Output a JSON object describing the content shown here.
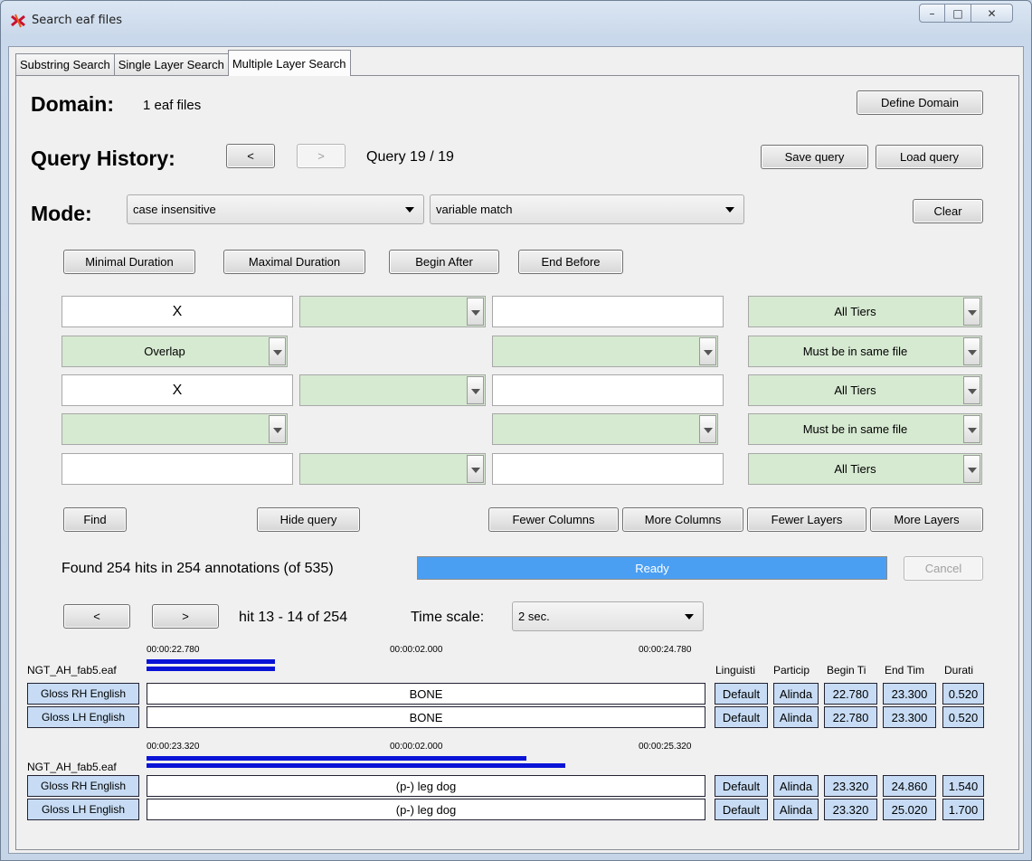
{
  "window": {
    "title": "Search eaf files",
    "controls": {
      "minimize": "–",
      "maximize": "□",
      "close": "✕"
    }
  },
  "tabs": [
    {
      "label": "Substring Search",
      "active": false
    },
    {
      "label": "Single Layer Search",
      "active": false
    },
    {
      "label": "Multiple Layer Search",
      "active": true
    }
  ],
  "domain": {
    "heading": "Domain:",
    "value": "1 eaf files",
    "define_button": "Define Domain"
  },
  "history": {
    "heading": "Query History:",
    "prev": "<",
    "next": ">",
    "status": "Query 19 / 19",
    "save_button": "Save query",
    "load_button": "Load query"
  },
  "mode": {
    "heading": "Mode:",
    "case_select": "case insensitive",
    "match_select": "variable match",
    "clear_button": "Clear"
  },
  "constraints": {
    "min_duration": "Minimal Duration",
    "max_duration": "Maximal Duration",
    "begin_after": "Begin After",
    "end_before": "End Before"
  },
  "query_grid": {
    "row1": {
      "pattern": "X",
      "op": "",
      "pattern2": "",
      "tiers": "All Tiers"
    },
    "rel1": {
      "relation": "Overlap",
      "op": "",
      "file": "Must be in same file"
    },
    "row2": {
      "pattern": "X",
      "op": "",
      "pattern2": "",
      "tiers": "All Tiers"
    },
    "rel2": {
      "relation": "",
      "op": "",
      "file": "Must be in same file"
    },
    "row3": {
      "pattern": "",
      "op": "",
      "pattern2": "",
      "tiers": "All Tiers"
    }
  },
  "actions": {
    "find": "Find",
    "hide_query": "Hide query",
    "fewer_columns": "Fewer Columns",
    "more_columns": "More Columns",
    "fewer_layers": "Fewer Layers",
    "more_layers": "More Layers"
  },
  "results": {
    "summary": "Found 254 hits in 254 annotations (of 535)",
    "progress_label": "Ready",
    "progress_value": 1.0,
    "cancel": "Cancel",
    "prev": "<",
    "next": ">",
    "hit_range": "hit 13 - 14 of 254",
    "timescale_label": "Time scale:",
    "timescale_value": "2 sec."
  },
  "column_headers": [
    "Linguisti",
    "Particip",
    "Begin Ti",
    "End Tim",
    "Durati"
  ],
  "hits": [
    {
      "file": "NGT_AH_fab5.eaf",
      "ticks": [
        "00:00:22.780",
        "00:00:02.000",
        "00:00:24.780"
      ],
      "rows": [
        {
          "tier": "Gloss RH English",
          "annotation": "BONE",
          "linguistic": "Default",
          "participant": "Alinda",
          "begin": "22.780",
          "end": "23.300",
          "duration": "0.520"
        },
        {
          "tier": "Gloss LH English",
          "annotation": "BONE",
          "linguistic": "Default",
          "participant": "Alinda",
          "begin": "22.780",
          "end": "23.300",
          "duration": "0.520"
        }
      ]
    },
    {
      "file": "NGT_AH_fab5.eaf",
      "ticks": [
        "00:00:23.320",
        "00:00:02.000",
        "00:00:25.320"
      ],
      "rows": [
        {
          "tier": "Gloss RH English",
          "annotation": "(p-) leg dog",
          "linguistic": "Default",
          "participant": "Alinda",
          "begin": "23.320",
          "end": "24.860",
          "duration": "1.540"
        },
        {
          "tier": "Gloss LH English",
          "annotation": "(p-) leg dog",
          "linguistic": "Default",
          "participant": "Alinda",
          "begin": "23.320",
          "end": "25.020",
          "duration": "1.700"
        }
      ]
    }
  ],
  "colors": {
    "bar": "#0a14d6",
    "progress": "#4b9ff2",
    "green_field": "#d6e9d1",
    "tier_bg": "#c7dcf4"
  }
}
